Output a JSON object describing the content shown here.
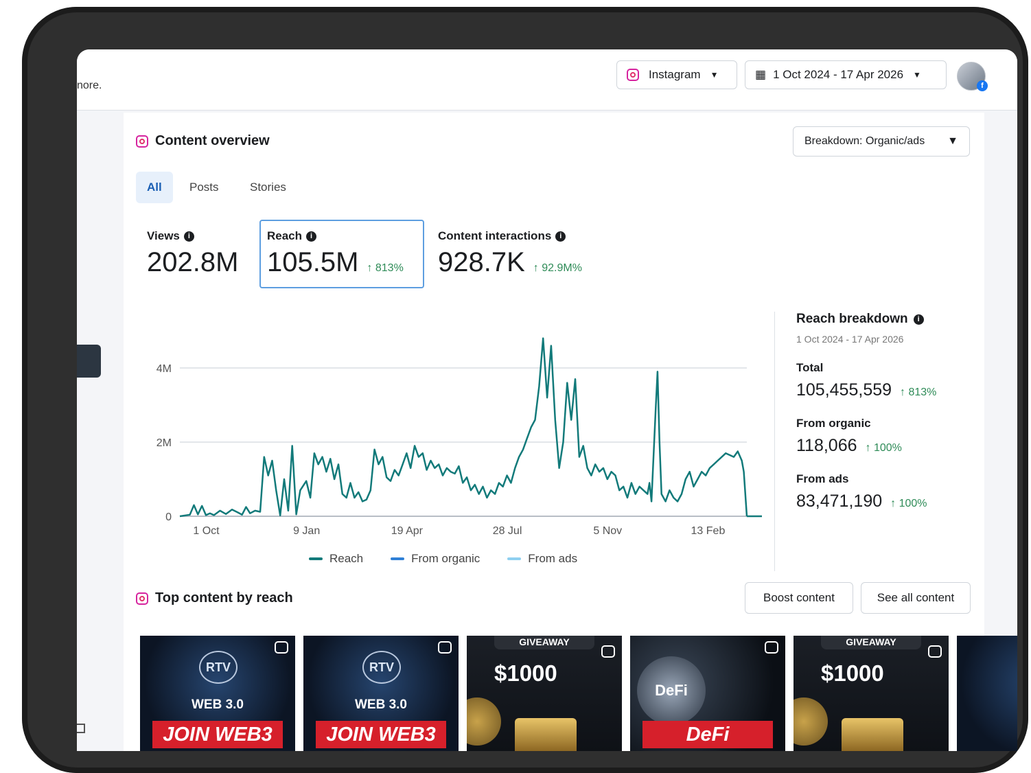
{
  "topbar": {
    "left_text": "nore.",
    "platform_label": "Instagram",
    "date_range_label": "1 Oct 2024 - 17 Apr 2026"
  },
  "overview": {
    "title": "Content overview",
    "breakdown_label": "Breakdown: Organic/ads",
    "tabs": [
      {
        "label": "All",
        "active": true
      },
      {
        "label": "Posts",
        "active": false
      },
      {
        "label": "Stories",
        "active": false
      }
    ],
    "metrics": [
      {
        "label": "Views",
        "value": "202.8M",
        "delta": ""
      },
      {
        "label": "Reach",
        "value": "105.5M",
        "delta": "↑ 813%"
      },
      {
        "label": "Content interactions",
        "value": "928.7K",
        "delta": "↑ 92.9M%"
      }
    ]
  },
  "chart_data": {
    "type": "line",
    "title": "",
    "xlabel": "",
    "ylabel": "",
    "x_tick_labels": [
      "1 Oct",
      "9 Jan",
      "19 Apr",
      "28 Jul",
      "5 Nov",
      "13 Feb"
    ],
    "y_tick_labels": [
      "0",
      "2M",
      "4M"
    ],
    "ylim": [
      0,
      5000000
    ],
    "grid": true,
    "legend_position": "bottom",
    "x_index_range": [
      0,
      565
    ],
    "series": [
      {
        "name": "Reach",
        "color": "#127a7a",
        "points": [
          [
            0,
            0
          ],
          [
            10,
            40000
          ],
          [
            14,
            300000
          ],
          [
            18,
            50000
          ],
          [
            22,
            280000
          ],
          [
            26,
            30000
          ],
          [
            30,
            80000
          ],
          [
            34,
            30000
          ],
          [
            40,
            150000
          ],
          [
            46,
            60000
          ],
          [
            52,
            180000
          ],
          [
            58,
            100000
          ],
          [
            62,
            40000
          ],
          [
            66,
            250000
          ],
          [
            70,
            80000
          ],
          [
            75,
            150000
          ],
          [
            80,
            120000
          ],
          [
            84,
            1600000
          ],
          [
            88,
            1100000
          ],
          [
            92,
            1500000
          ],
          [
            96,
            700000
          ],
          [
            100,
            20000
          ],
          [
            104,
            1000000
          ],
          [
            108,
            150000
          ],
          [
            112,
            1900000
          ],
          [
            116,
            50000
          ],
          [
            120,
            700000
          ],
          [
            126,
            950000
          ],
          [
            130,
            500000
          ],
          [
            134,
            1700000
          ],
          [
            138,
            1400000
          ],
          [
            142,
            1600000
          ],
          [
            146,
            1200000
          ],
          [
            150,
            1550000
          ],
          [
            154,
            1000000
          ],
          [
            158,
            1400000
          ],
          [
            162,
            600000
          ],
          [
            166,
            500000
          ],
          [
            170,
            900000
          ],
          [
            174,
            500000
          ],
          [
            178,
            650000
          ],
          [
            182,
            400000
          ],
          [
            186,
            450000
          ],
          [
            190,
            700000
          ],
          [
            194,
            1800000
          ],
          [
            198,
            1400000
          ],
          [
            202,
            1600000
          ],
          [
            206,
            1050000
          ],
          [
            210,
            950000
          ],
          [
            214,
            1250000
          ],
          [
            218,
            1100000
          ],
          [
            222,
            1400000
          ],
          [
            226,
            1700000
          ],
          [
            230,
            1300000
          ],
          [
            234,
            1900000
          ],
          [
            238,
            1600000
          ],
          [
            242,
            1700000
          ],
          [
            246,
            1250000
          ],
          [
            250,
            1500000
          ],
          [
            254,
            1300000
          ],
          [
            258,
            1400000
          ],
          [
            262,
            1100000
          ],
          [
            266,
            1300000
          ],
          [
            270,
            1200000
          ],
          [
            274,
            1150000
          ],
          [
            278,
            1350000
          ],
          [
            282,
            900000
          ],
          [
            286,
            1050000
          ],
          [
            290,
            700000
          ],
          [
            294,
            850000
          ],
          [
            298,
            600000
          ],
          [
            302,
            800000
          ],
          [
            306,
            500000
          ],
          [
            310,
            700000
          ],
          [
            314,
            600000
          ],
          [
            318,
            900000
          ],
          [
            322,
            800000
          ],
          [
            326,
            1100000
          ],
          [
            330,
            900000
          ],
          [
            334,
            1300000
          ],
          [
            338,
            1600000
          ],
          [
            342,
            1800000
          ],
          [
            346,
            2100000
          ],
          [
            350,
            2400000
          ],
          [
            354,
            2600000
          ],
          [
            358,
            3500000
          ],
          [
            362,
            4800000
          ],
          [
            366,
            3200000
          ],
          [
            370,
            4600000
          ],
          [
            374,
            2600000
          ],
          [
            378,
            1300000
          ],
          [
            382,
            2000000
          ],
          [
            386,
            3600000
          ],
          [
            390,
            2600000
          ],
          [
            394,
            3700000
          ],
          [
            398,
            1600000
          ],
          [
            402,
            1900000
          ],
          [
            406,
            1300000
          ],
          [
            410,
            1100000
          ],
          [
            414,
            1400000
          ],
          [
            418,
            1200000
          ],
          [
            422,
            1300000
          ],
          [
            426,
            1000000
          ],
          [
            430,
            1200000
          ],
          [
            434,
            1100000
          ],
          [
            438,
            700000
          ],
          [
            442,
            800000
          ],
          [
            446,
            500000
          ],
          [
            450,
            900000
          ],
          [
            454,
            600000
          ],
          [
            458,
            800000
          ],
          [
            462,
            700000
          ],
          [
            466,
            600000
          ],
          [
            468,
            900000
          ],
          [
            470,
            400000
          ],
          [
            474,
            2800000
          ],
          [
            476,
            3900000
          ],
          [
            478,
            2000000
          ],
          [
            480,
            600000
          ],
          [
            484,
            400000
          ],
          [
            488,
            700000
          ],
          [
            492,
            500000
          ],
          [
            496,
            400000
          ],
          [
            500,
            600000
          ],
          [
            504,
            1000000
          ],
          [
            508,
            1200000
          ],
          [
            512,
            800000
          ],
          [
            516,
            1000000
          ],
          [
            520,
            1200000
          ],
          [
            524,
            1100000
          ],
          [
            528,
            1300000
          ],
          [
            532,
            1400000
          ],
          [
            536,
            1500000
          ],
          [
            540,
            1600000
          ],
          [
            544,
            1700000
          ],
          [
            548,
            1650000
          ],
          [
            552,
            1600000
          ],
          [
            556,
            1750000
          ],
          [
            560,
            1500000
          ],
          [
            562,
            1200000
          ],
          [
            565,
            0
          ]
        ]
      },
      {
        "name": "From organic",
        "color": "#2f80d6",
        "points": []
      },
      {
        "name": "From ads",
        "color": "#8fd0f0",
        "points": []
      }
    ]
  },
  "reach_breakdown": {
    "title": "Reach breakdown",
    "date_range": "1 Oct 2024 - 17 Apr 2026",
    "items": [
      {
        "label": "Total",
        "value": "105,455,559",
        "delta": "↑ 813%"
      },
      {
        "label": "From organic",
        "value": "118,066",
        "delta": "↑ 100%"
      },
      {
        "label": "From ads",
        "value": "83,471,190",
        "delta": "↑ 100%"
      }
    ]
  },
  "top_content": {
    "title": "Top content by reach",
    "boost_label": "Boost content",
    "see_all_label": "See all content",
    "thumbnails": [
      {
        "type": "web3",
        "logo": "RTV",
        "mid": "WEB 3.0",
        "banner": "JOIN WEB3"
      },
      {
        "type": "web3",
        "logo": "RTV",
        "mid": "WEB 3.0",
        "banner": "JOIN WEB3"
      },
      {
        "type": "giveaway",
        "top": "GIVEAWAY",
        "amount": "$1000"
      },
      {
        "type": "defi",
        "logo": "DeFi",
        "banner": "DeFi"
      },
      {
        "type": "giveaway",
        "top": "GIVEAWAY",
        "amount": "$1000"
      }
    ]
  }
}
